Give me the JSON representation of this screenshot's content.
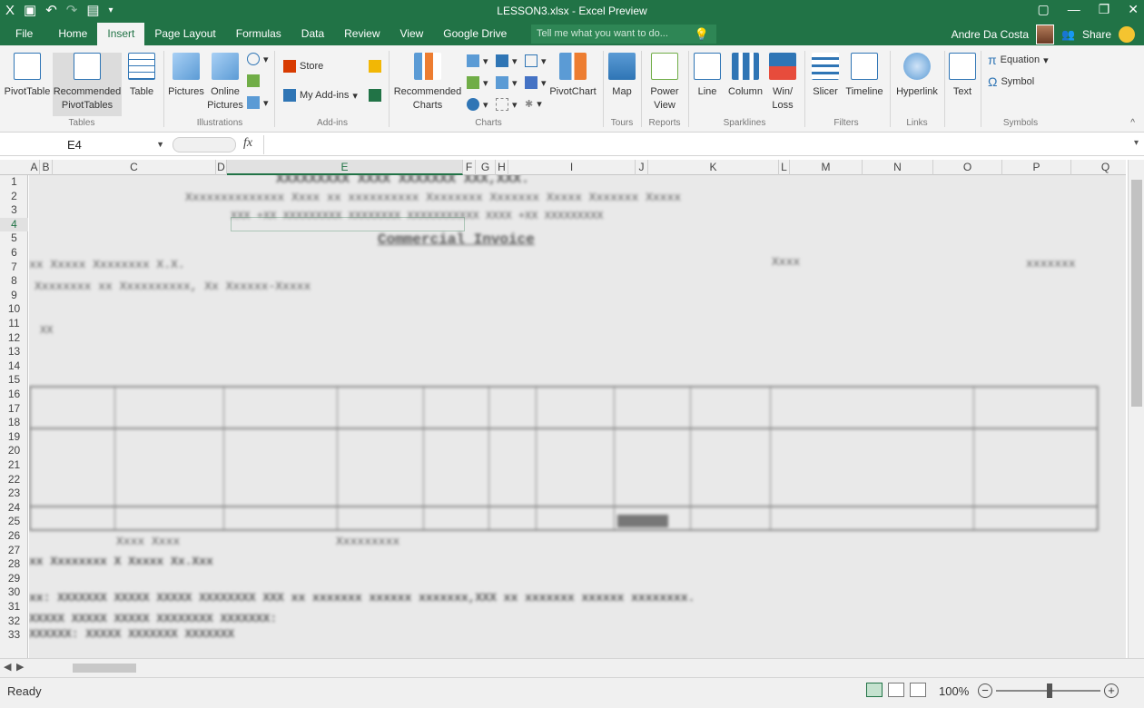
{
  "window": {
    "title": "LESSON3.xlsx - Excel Preview",
    "controls": [
      "▢",
      "—",
      "❐",
      "✕"
    ]
  },
  "qat": [
    "X",
    "💾",
    "↶",
    "↷",
    "▾"
  ],
  "tabs": [
    {
      "label": "File",
      "active": false
    },
    {
      "label": "Home",
      "active": false
    },
    {
      "label": "Insert",
      "active": true
    },
    {
      "label": "Page Layout",
      "active": false
    },
    {
      "label": "Formulas",
      "active": false
    },
    {
      "label": "Data",
      "active": false
    },
    {
      "label": "Review",
      "active": false
    },
    {
      "label": "View",
      "active": false
    },
    {
      "label": "Google Drive",
      "active": false
    }
  ],
  "tellme": {
    "placeholder": "Tell me what you want to do...",
    "icon": "lightbulb-icon"
  },
  "user": {
    "name": "Andre Da Costa",
    "share": "Share"
  },
  "ribbon": {
    "groups": {
      "tables": "Tables",
      "illustrations": "Illustrations",
      "addins": "Add-ins",
      "charts": "Charts",
      "tours": "Tours",
      "reports": "Reports",
      "sparklines": "Sparklines",
      "filters": "Filters",
      "links": "Links",
      "symbols": "Symbols"
    },
    "buttons": {
      "pivottable": "PivotTable",
      "rec_pivot_1": "Recommended",
      "rec_pivot_2": "PivotTables",
      "table": "Table",
      "pictures": "Pictures",
      "online_pictures_1": "Online",
      "online_pictures_2": "Pictures",
      "store": "Store",
      "my_addins": "My Add-ins",
      "rec_charts_1": "Recommended",
      "rec_charts_2": "Charts",
      "pivotchart": "PivotChart",
      "map": "Map",
      "power_view_1": "Power",
      "power_view_2": "View",
      "line": "Line",
      "column": "Column",
      "winloss_1": "Win/",
      "winloss_2": "Loss",
      "slicer": "Slicer",
      "timeline": "Timeline",
      "hyperlink": "Hyperlink",
      "text": "Text",
      "equation": "Equation",
      "symbol": "Symbol"
    }
  },
  "formula_bar": {
    "name_box": "E4",
    "fx": "fx",
    "content": ""
  },
  "columns": [
    "A",
    "B",
    "C",
    "D",
    "E",
    "F",
    "G",
    "H",
    "I",
    "J",
    "K",
    "L",
    "M",
    "N",
    "O",
    "P",
    "Q"
  ],
  "selected_column": "E",
  "rows": [
    "1",
    "2",
    "3",
    "4",
    "5",
    "6",
    "7",
    "8",
    "9",
    "10",
    "11",
    "12",
    "13",
    "14",
    "15",
    "16",
    "17",
    "18",
    "19",
    "20",
    "21",
    "22",
    "23",
    "24",
    "25",
    "26",
    "27",
    "28",
    "29",
    "30",
    "31",
    "32",
    "33"
  ],
  "selected_row": "4",
  "blurred_text": {
    "header1": "XXXXXXXXX XXXX XXXXXXX XXX,XXX.",
    "header2": "Xxxxxxxxxxxxxx Xxxx xx xxxxxxxxxx Xxxxxxxx Xxxxxxx Xxxxx Xxxxxxx Xxxxx",
    "header3": "XXX +XX XXXXXXXXX XXXXXXXX XXXXXXXXXXX XXXX +XX XXXXXXXXX",
    "heading": "Commercial Invoice",
    "to_line": "xx Xxxxx Xxxxxxxx X.X.",
    "date_label": "Xxxx",
    "date_value": "xxxxxxx",
    "addr_line": "Xxxxxxxx xx Xxxxxxxxxx, Xx Xxxxxx-Xxxxx",
    "row12": "XX",
    "footer1": "xx: XXXXXXX XXXXX XXXXX XXXXXXXX XXX xx xxxxxxx xxxxxx xxxxxxx,XXX xx xxxxxxx xxxxxx xxxxxxxx.",
    "footer2": "XXXXX XXXXX XXXXX XXXXXXXX XXXXXXX:",
    "footer3": "XXXXXX: XXXXX XXXXXXX XXXXXXX",
    "sig_left": "Xxxx Xxxx",
    "sig_right": "Xxxxxxxxx",
    "company": "xx Xxxxxxxx X Xxxxx Xx.Xxx"
  },
  "status": {
    "ready": "Ready",
    "zoom": "100%",
    "minus": "−",
    "plus": "+"
  }
}
